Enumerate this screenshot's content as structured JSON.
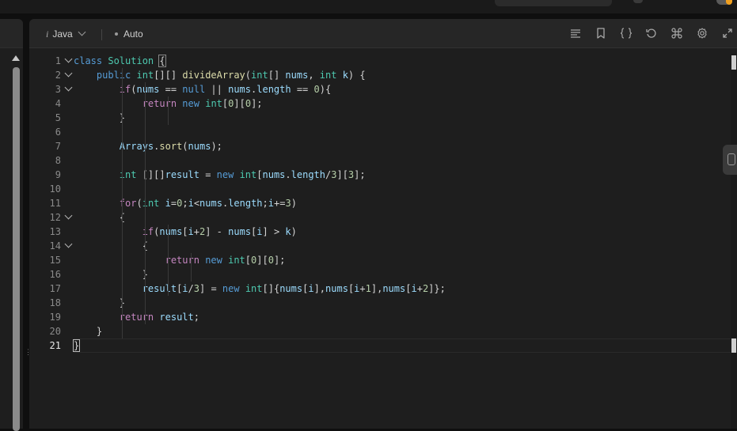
{
  "editor": {
    "language": "Java",
    "mode": "Auto",
    "info_glyph": "i",
    "active_line": 21,
    "folds": [
      1,
      2,
      3,
      12,
      14
    ],
    "toolbar_icons": [
      "format-icon",
      "bookmark-icon",
      "braces-icon",
      "reset-icon",
      "command-icon",
      "settings-icon",
      "expand-icon"
    ],
    "lines": [
      [
        [
          "kw",
          "class"
        ],
        [
          "plain",
          " "
        ],
        [
          "ty",
          "Solution"
        ],
        [
          "plain",
          " "
        ],
        [
          "brace",
          "{"
        ]
      ],
      [
        [
          "plain",
          "    "
        ],
        [
          "kw",
          "public"
        ],
        [
          "plain",
          " "
        ],
        [
          "ty",
          "int"
        ],
        [
          "plain",
          "[][] "
        ],
        [
          "fn",
          "divideArray"
        ],
        [
          "plain",
          "("
        ],
        [
          "ty",
          "int"
        ],
        [
          "plain",
          "[] "
        ],
        [
          "var",
          "nums"
        ],
        [
          "plain",
          ", "
        ],
        [
          "ty",
          "int"
        ],
        [
          "plain",
          " "
        ],
        [
          "var",
          "k"
        ],
        [
          "plain",
          ") {"
        ]
      ],
      [
        [
          "plain",
          "        "
        ],
        [
          "ctl",
          "if"
        ],
        [
          "plain",
          "("
        ],
        [
          "var",
          "nums"
        ],
        [
          "plain",
          " == "
        ],
        [
          "lit",
          "null"
        ],
        [
          "plain",
          " || "
        ],
        [
          "var",
          "nums"
        ],
        [
          "plain",
          "."
        ],
        [
          "var",
          "length"
        ],
        [
          "plain",
          " == "
        ],
        [
          "num",
          "0"
        ],
        [
          "plain",
          "){"
        ]
      ],
      [
        [
          "plain",
          "            "
        ],
        [
          "ctl",
          "return"
        ],
        [
          "plain",
          " "
        ],
        [
          "kw",
          "new"
        ],
        [
          "plain",
          " "
        ],
        [
          "ty",
          "int"
        ],
        [
          "plain",
          "["
        ],
        [
          "num",
          "0"
        ],
        [
          "plain",
          "]["
        ],
        [
          "num",
          "0"
        ],
        [
          "plain",
          "];"
        ]
      ],
      [
        [
          "plain",
          "        }"
        ]
      ],
      [
        [
          "plain",
          ""
        ]
      ],
      [
        [
          "plain",
          "        "
        ],
        [
          "var",
          "Arrays"
        ],
        [
          "plain",
          "."
        ],
        [
          "fn",
          "sort"
        ],
        [
          "plain",
          "("
        ],
        [
          "var",
          "nums"
        ],
        [
          "plain",
          ");"
        ]
      ],
      [
        [
          "plain",
          ""
        ]
      ],
      [
        [
          "plain",
          "        "
        ],
        [
          "ty",
          "int"
        ],
        [
          "plain",
          " [][]"
        ],
        [
          "var",
          "result"
        ],
        [
          "plain",
          " = "
        ],
        [
          "kw",
          "new"
        ],
        [
          "plain",
          " "
        ],
        [
          "ty",
          "int"
        ],
        [
          "plain",
          "["
        ],
        [
          "var",
          "nums"
        ],
        [
          "plain",
          "."
        ],
        [
          "var",
          "length"
        ],
        [
          "plain",
          "/"
        ],
        [
          "num",
          "3"
        ],
        [
          "plain",
          "]["
        ],
        [
          "num",
          "3"
        ],
        [
          "plain",
          "];"
        ]
      ],
      [
        [
          "plain",
          ""
        ]
      ],
      [
        [
          "plain",
          "        "
        ],
        [
          "ctl",
          "for"
        ],
        [
          "plain",
          "("
        ],
        [
          "ty",
          "int"
        ],
        [
          "plain",
          " "
        ],
        [
          "var",
          "i"
        ],
        [
          "plain",
          "="
        ],
        [
          "num",
          "0"
        ],
        [
          "plain",
          ";"
        ],
        [
          "var",
          "i"
        ],
        [
          "plain",
          "<"
        ],
        [
          "var",
          "nums"
        ],
        [
          "plain",
          "."
        ],
        [
          "var",
          "length"
        ],
        [
          "plain",
          ";"
        ],
        [
          "var",
          "i"
        ],
        [
          "plain",
          "+="
        ],
        [
          "num",
          "3"
        ],
        [
          "plain",
          ")"
        ]
      ],
      [
        [
          "plain",
          "        {"
        ]
      ],
      [
        [
          "plain",
          "            "
        ],
        [
          "ctl",
          "if"
        ],
        [
          "plain",
          "("
        ],
        [
          "var",
          "nums"
        ],
        [
          "plain",
          "["
        ],
        [
          "var",
          "i"
        ],
        [
          "plain",
          "+"
        ],
        [
          "num",
          "2"
        ],
        [
          "plain",
          "] - "
        ],
        [
          "var",
          "nums"
        ],
        [
          "plain",
          "["
        ],
        [
          "var",
          "i"
        ],
        [
          "plain",
          "] > "
        ],
        [
          "var",
          "k"
        ],
        [
          "plain",
          ")"
        ]
      ],
      [
        [
          "plain",
          "            {"
        ]
      ],
      [
        [
          "plain",
          "                "
        ],
        [
          "ctl",
          "return"
        ],
        [
          "plain",
          " "
        ],
        [
          "kw",
          "new"
        ],
        [
          "plain",
          " "
        ],
        [
          "ty",
          "int"
        ],
        [
          "plain",
          "["
        ],
        [
          "num",
          "0"
        ],
        [
          "plain",
          "]["
        ],
        [
          "num",
          "0"
        ],
        [
          "plain",
          "];"
        ]
      ],
      [
        [
          "plain",
          "            }"
        ]
      ],
      [
        [
          "plain",
          "            "
        ],
        [
          "var",
          "result"
        ],
        [
          "plain",
          "["
        ],
        [
          "var",
          "i"
        ],
        [
          "plain",
          "/"
        ],
        [
          "num",
          "3"
        ],
        [
          "plain",
          "] = "
        ],
        [
          "kw",
          "new"
        ],
        [
          "plain",
          " "
        ],
        [
          "ty",
          "int"
        ],
        [
          "plain",
          "[]{"
        ],
        [
          "var",
          "nums"
        ],
        [
          "plain",
          "["
        ],
        [
          "var",
          "i"
        ],
        [
          "plain",
          "],"
        ],
        [
          "var",
          "nums"
        ],
        [
          "plain",
          "["
        ],
        [
          "var",
          "i"
        ],
        [
          "plain",
          "+"
        ],
        [
          "num",
          "1"
        ],
        [
          "plain",
          "],"
        ],
        [
          "var",
          "nums"
        ],
        [
          "plain",
          "["
        ],
        [
          "var",
          "i"
        ],
        [
          "plain",
          "+"
        ],
        [
          "num",
          "2"
        ],
        [
          "plain",
          "]};"
        ]
      ],
      [
        [
          "plain",
          "        }"
        ]
      ],
      [
        [
          "plain",
          "        "
        ],
        [
          "ctl",
          "return"
        ],
        [
          "plain",
          " "
        ],
        [
          "var",
          "result"
        ],
        [
          "plain",
          ";"
        ]
      ],
      [
        [
          "plain",
          "    }"
        ]
      ],
      [
        [
          "cursor",
          "}"
        ]
      ]
    ]
  }
}
